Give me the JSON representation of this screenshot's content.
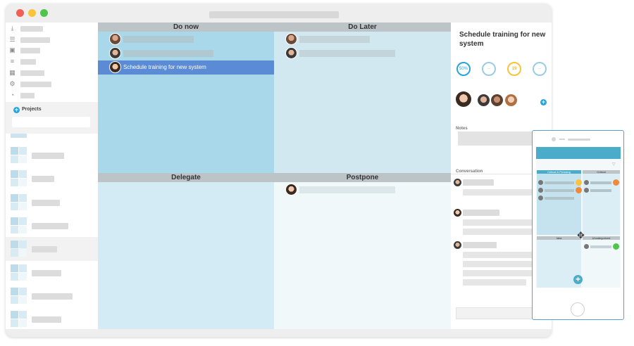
{
  "window": {
    "controls": {
      "close_color": "#f35f55",
      "minimize_color": "#f9c33a",
      "maximize_color": "#4ec54b"
    }
  },
  "sidebar": {
    "nav_icons": [
      "download-icon",
      "checklist-icon",
      "image-icon",
      "list-icon",
      "calendar-icon",
      "rss-settings-icon",
      "rss-icon"
    ],
    "projects_label": "Projects",
    "add_icon": "+"
  },
  "matrix": {
    "quadrants": [
      {
        "label": "Do now",
        "color": "#a8d8ea"
      },
      {
        "label": "Do Later",
        "color": "#d2e8f1"
      },
      {
        "label": "Delegate",
        "color": "#d3ebf4"
      },
      {
        "label": "Postpone",
        "color": "#f0f8fa"
      }
    ],
    "selected_task": "Schedule training for new system"
  },
  "detail": {
    "title": "Schedule training for new system",
    "progress": "50%",
    "progress_value": 0.5,
    "priority_num": "19",
    "ring1": "--",
    "ring2": "--",
    "notes_label": "Notes",
    "conversation_label": "Conversation",
    "add_icon": "+"
  },
  "phone": {
    "quadrant_labels": [
      "Critical & Pressing",
      "Critical",
      "Idea",
      "Uncategorized"
    ],
    "add_icon": "+",
    "move_icon": "✥"
  },
  "colors": {
    "accent": "#2aa3d8",
    "selected": "#5b8bd5",
    "phone_header": "#4aacc8",
    "yellow": "#f9c33a",
    "orange": "#f08a3a",
    "green": "#4ec54b"
  }
}
